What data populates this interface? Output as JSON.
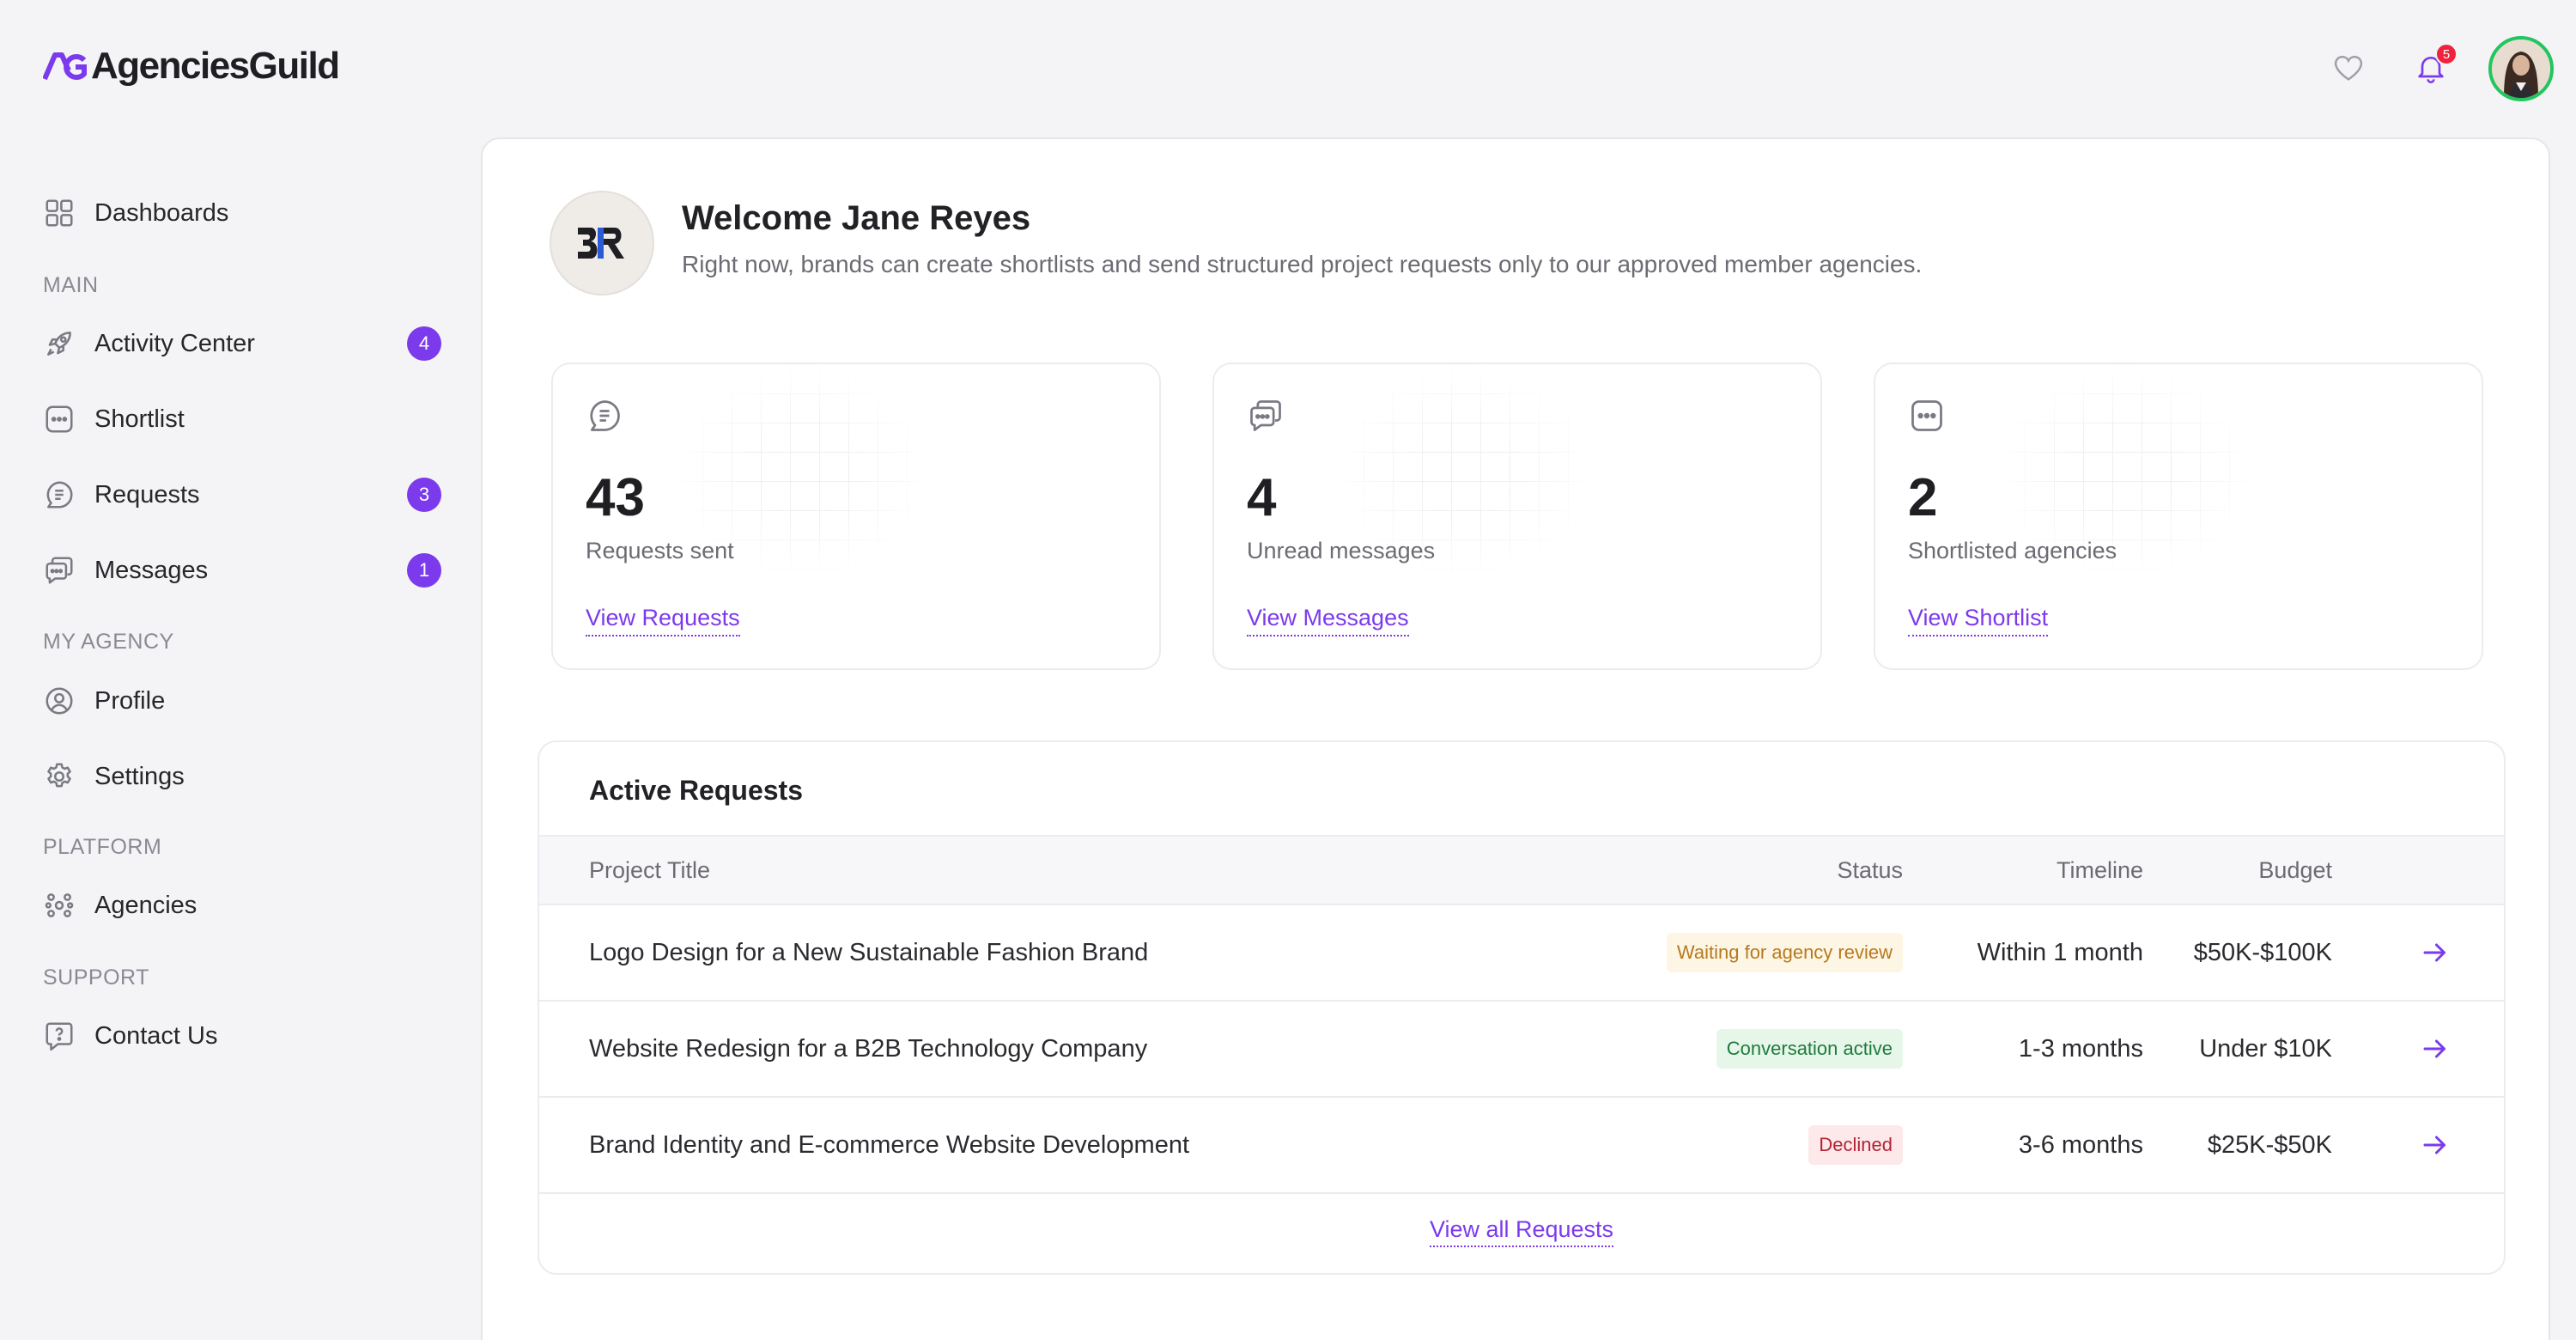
{
  "app": {
    "name": "AgenciesGuild",
    "accent": "#7c3aed"
  },
  "sidebar": {
    "dashboards": {
      "label": "Dashboards",
      "icon": "grid-icon"
    },
    "sections": {
      "main": "MAIN",
      "my_agency": "MY AGENCY",
      "platform": "PLATFORM",
      "support": "SUPPORT"
    },
    "items": [
      {
        "label": "Activity Center",
        "icon": "rocket-icon",
        "badge": "4"
      },
      {
        "label": "Shortlist",
        "icon": "chat-dots-icon",
        "badge": ""
      },
      {
        "label": "Requests",
        "icon": "document-bubble-icon",
        "badge": "3"
      },
      {
        "label": "Messages",
        "icon": "messages-icon",
        "badge": "1"
      },
      {
        "label": "Profile",
        "icon": "user-circle-icon",
        "badge": ""
      },
      {
        "label": "Settings",
        "icon": "gear-icon",
        "badge": ""
      },
      {
        "label": "Agencies",
        "icon": "users-icon",
        "badge": ""
      },
      {
        "label": "Contact Us",
        "icon": "help-bubble-icon",
        "badge": ""
      }
    ]
  },
  "topbar": {
    "notifications_count": "5"
  },
  "welcome": {
    "title": "Welcome Jane Reyes",
    "subtitle": "Right now, brands can create shortlists and send structured project requests only to our approved member agencies."
  },
  "stats": [
    {
      "value": "43",
      "label": "Requests sent",
      "link": "View Requests",
      "icon": "document-bubble-icon"
    },
    {
      "value": "4",
      "label": "Unread messages",
      "link": "View Messages",
      "icon": "messages-icon"
    },
    {
      "value": "2",
      "label": "Shortlisted agencies",
      "link": "View Shortlist",
      "icon": "chat-dots-icon"
    }
  ],
  "active_requests": {
    "title": "Active Requests",
    "columns": {
      "project": "Project Title",
      "status": "Status",
      "timeline": "Timeline",
      "budget": "Budget"
    },
    "rows": [
      {
        "project": "Logo Design for a New Sustainable Fashion Brand",
        "status": "Waiting for agency review",
        "status_bg": "#fef6e4",
        "status_fg": "#b7791f",
        "timeline": "Within 1 month",
        "budget": "$50K-$100K"
      },
      {
        "project": "Website Redesign for a B2B Technology Company",
        "status": "Conversation active",
        "status_bg": "#e6f7ea",
        "status_fg": "#1e7a3c",
        "timeline": "1-3 months",
        "budget": "Under $10K"
      },
      {
        "project": "Brand Identity and E-commerce Website Development",
        "status": "Declined",
        "status_bg": "#fde8ea",
        "status_fg": "#b42335",
        "timeline": "3-6 months",
        "budget": "$25K-$50K"
      }
    ],
    "view_all": "View all Requests"
  }
}
